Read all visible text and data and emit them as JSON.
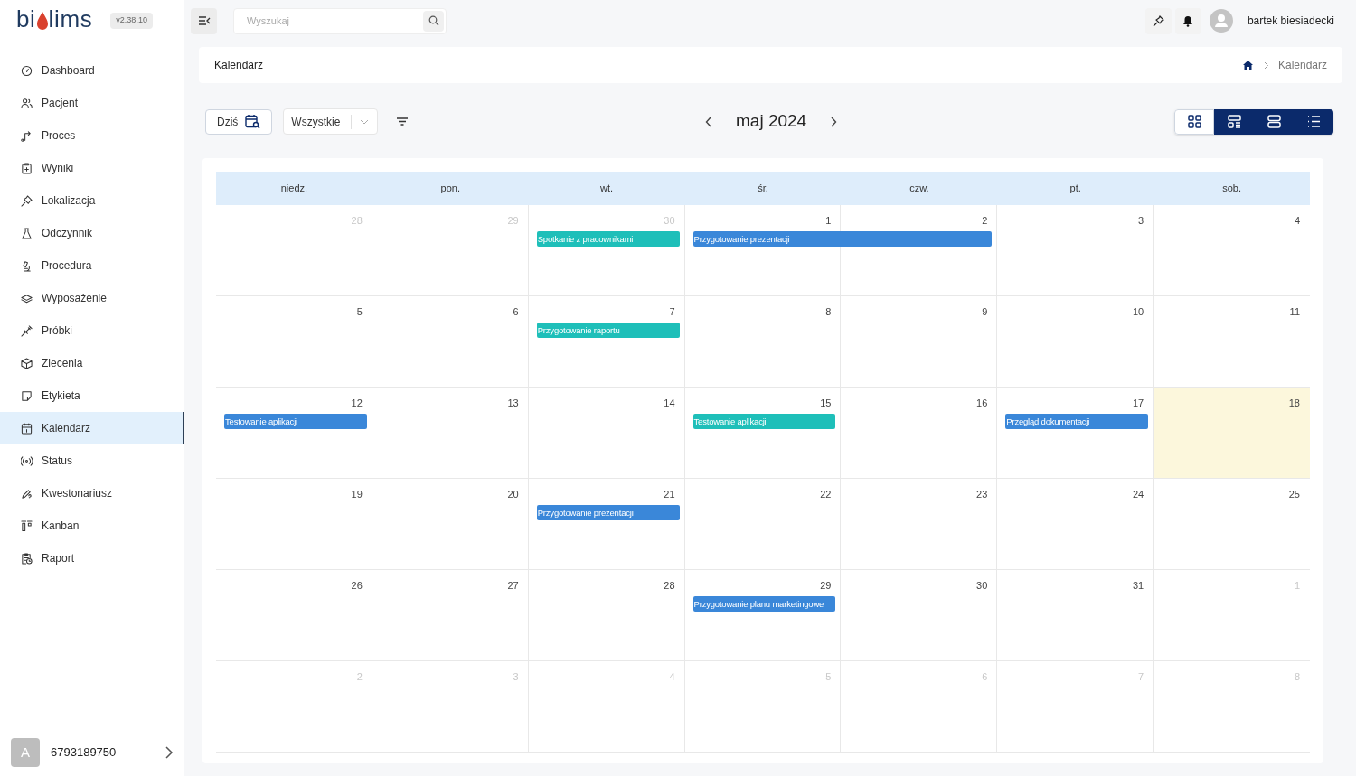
{
  "logo": {
    "left": "bi",
    "right": "lims"
  },
  "version": "v2.38.10",
  "search": {
    "placeholder": "Wyszukaj"
  },
  "user": {
    "name": "bartek biesiadecki"
  },
  "sidebar": {
    "items": [
      {
        "label": "Dashboard",
        "selected": false
      },
      {
        "label": "Pacjent",
        "selected": false
      },
      {
        "label": "Proces",
        "selected": false
      },
      {
        "label": "Wyniki",
        "selected": false
      },
      {
        "label": "Lokalizacja",
        "selected": false
      },
      {
        "label": "Odczynnik",
        "selected": false
      },
      {
        "label": "Procedura",
        "selected": false
      },
      {
        "label": "Wyposażenie",
        "selected": false
      },
      {
        "label": "Próbki",
        "selected": false
      },
      {
        "label": "Zlecenia",
        "selected": false
      },
      {
        "label": "Etykieta",
        "selected": false
      },
      {
        "label": "Kalendarz",
        "selected": true
      },
      {
        "label": "Status",
        "selected": false
      },
      {
        "label": "Kwestonariusz",
        "selected": false
      },
      {
        "label": "Kanban",
        "selected": false
      },
      {
        "label": "Raport",
        "selected": false
      }
    ],
    "account": {
      "initial": "A",
      "number": "6793189750"
    }
  },
  "breadcrumb": {
    "title": "Kalendarz",
    "trail": "Kalendarz"
  },
  "toolbar": {
    "today": "Dziś",
    "filter": {
      "value": "Wszystkie"
    },
    "month": "maj 2024",
    "views": [
      {
        "kind": "grid",
        "selected": true
      },
      {
        "kind": "agenda",
        "selected": false
      },
      {
        "kind": "rows",
        "selected": false
      },
      {
        "kind": "list",
        "selected": false
      }
    ]
  },
  "calendar": {
    "weekdays": [
      "niedz.",
      "pon.",
      "wt.",
      "śr.",
      "czw.",
      "pt.",
      "sob."
    ],
    "weeks": [
      {
        "days": [
          {
            "n": "28",
            "muted": true
          },
          {
            "n": "29",
            "muted": true
          },
          {
            "n": "30",
            "muted": true,
            "events": [
              {
                "title": "Spotkanie z pracownikami",
                "continues": false,
                "color": "#1ebfb9"
              }
            ]
          },
          {
            "n": "1",
            "muted": false,
            "events": [
              {
                "title": "Przygotowanie prezentacji",
                "continues": true,
                "color": "#3a87d9"
              }
            ]
          },
          {
            "n": "2",
            "muted": false
          },
          {
            "n": "3",
            "muted": false
          },
          {
            "n": "4",
            "muted": false
          }
        ]
      },
      {
        "days": [
          {
            "n": "5",
            "muted": false
          },
          {
            "n": "6",
            "muted": false
          },
          {
            "n": "7",
            "muted": false,
            "events": [
              {
                "title": "Przygotowanie raportu",
                "continues": false,
                "color": "#1ebfb9"
              }
            ]
          },
          {
            "n": "8",
            "muted": false
          },
          {
            "n": "9",
            "muted": false
          },
          {
            "n": "10",
            "muted": false
          },
          {
            "n": "11",
            "muted": false
          }
        ]
      },
      {
        "days": [
          {
            "n": "12",
            "muted": false,
            "events": [
              {
                "title": "Testowanie aplikacji",
                "continues": false,
                "color": "#3a87d9"
              }
            ]
          },
          {
            "n": "13",
            "muted": false
          },
          {
            "n": "14",
            "muted": false
          },
          {
            "n": "15",
            "muted": false,
            "events": [
              {
                "title": "Testowanie aplikacji",
                "continues": false,
                "color": "#1ebfb9"
              }
            ]
          },
          {
            "n": "16",
            "muted": false
          },
          {
            "n": "17",
            "muted": false,
            "events": [
              {
                "title": "Przegląd dokumentacji",
                "continues": false,
                "color": "#3a87d9"
              }
            ]
          },
          {
            "n": "18",
            "muted": false,
            "today": true
          }
        ]
      },
      {
        "days": [
          {
            "n": "19",
            "muted": false
          },
          {
            "n": "20",
            "muted": false
          },
          {
            "n": "21",
            "muted": false,
            "events": [
              {
                "title": "Przygotowanie prezentacji",
                "continues": false,
                "color": "#3a87d9"
              }
            ]
          },
          {
            "n": "22",
            "muted": false
          },
          {
            "n": "23",
            "muted": false
          },
          {
            "n": "24",
            "muted": false
          },
          {
            "n": "25",
            "muted": false
          }
        ]
      },
      {
        "days": [
          {
            "n": "26",
            "muted": false
          },
          {
            "n": "27",
            "muted": false
          },
          {
            "n": "28",
            "muted": false
          },
          {
            "n": "29",
            "muted": false,
            "events": [
              {
                "title": "Przygotowanie planu marketingowe",
                "continues": false,
                "color": "#3a87d9"
              }
            ]
          },
          {
            "n": "30",
            "muted": false
          },
          {
            "n": "31",
            "muted": false
          },
          {
            "n": "1",
            "muted": true
          }
        ]
      },
      {
        "days": [
          {
            "n": "2",
            "muted": true
          },
          {
            "n": "3",
            "muted": true
          },
          {
            "n": "4",
            "muted": true
          },
          {
            "n": "5",
            "muted": true
          },
          {
            "n": "6",
            "muted": true
          },
          {
            "n": "7",
            "muted": true
          },
          {
            "n": "8",
            "muted": true
          }
        ]
      }
    ]
  }
}
